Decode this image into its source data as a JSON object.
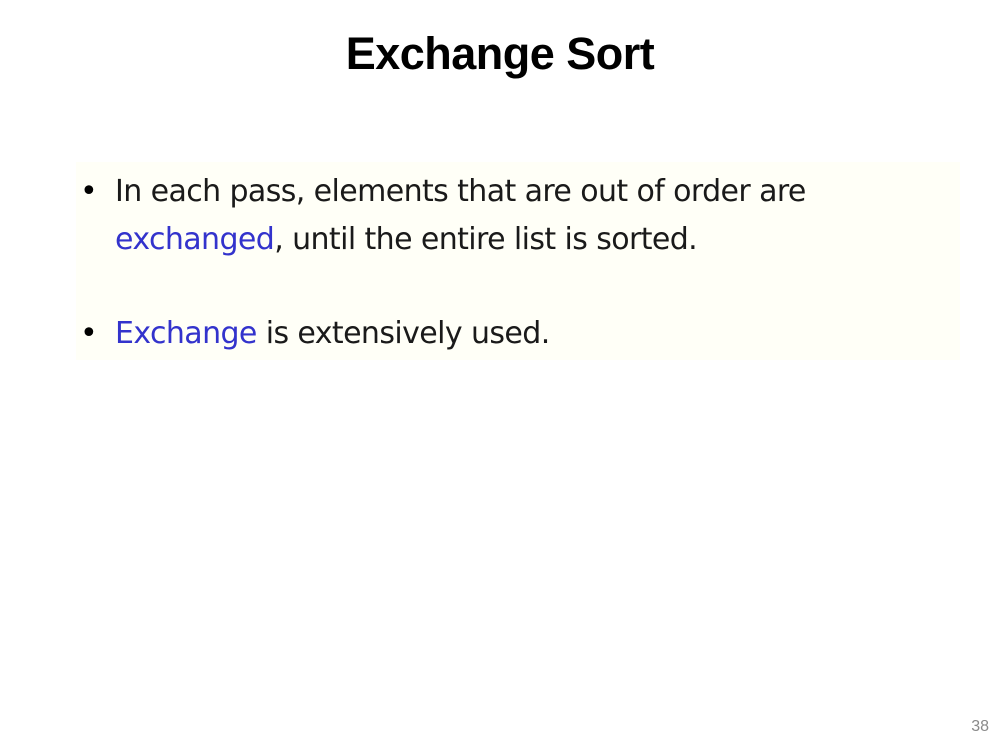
{
  "slide": {
    "title": "Exchange Sort",
    "page_number": "38",
    "bullets": [
      {
        "highlight_word": "",
        "pre": "In each pass, elements that are out of order are ",
        "highlight": "exchanged",
        "post": ", until the entire list is sorted."
      },
      {
        "highlight": "Exchange",
        "post": " is extensively used."
      }
    ]
  },
  "colors": {
    "highlight": "#3333cc",
    "text": "#1a1a1a",
    "content_background": "#fffff7"
  }
}
